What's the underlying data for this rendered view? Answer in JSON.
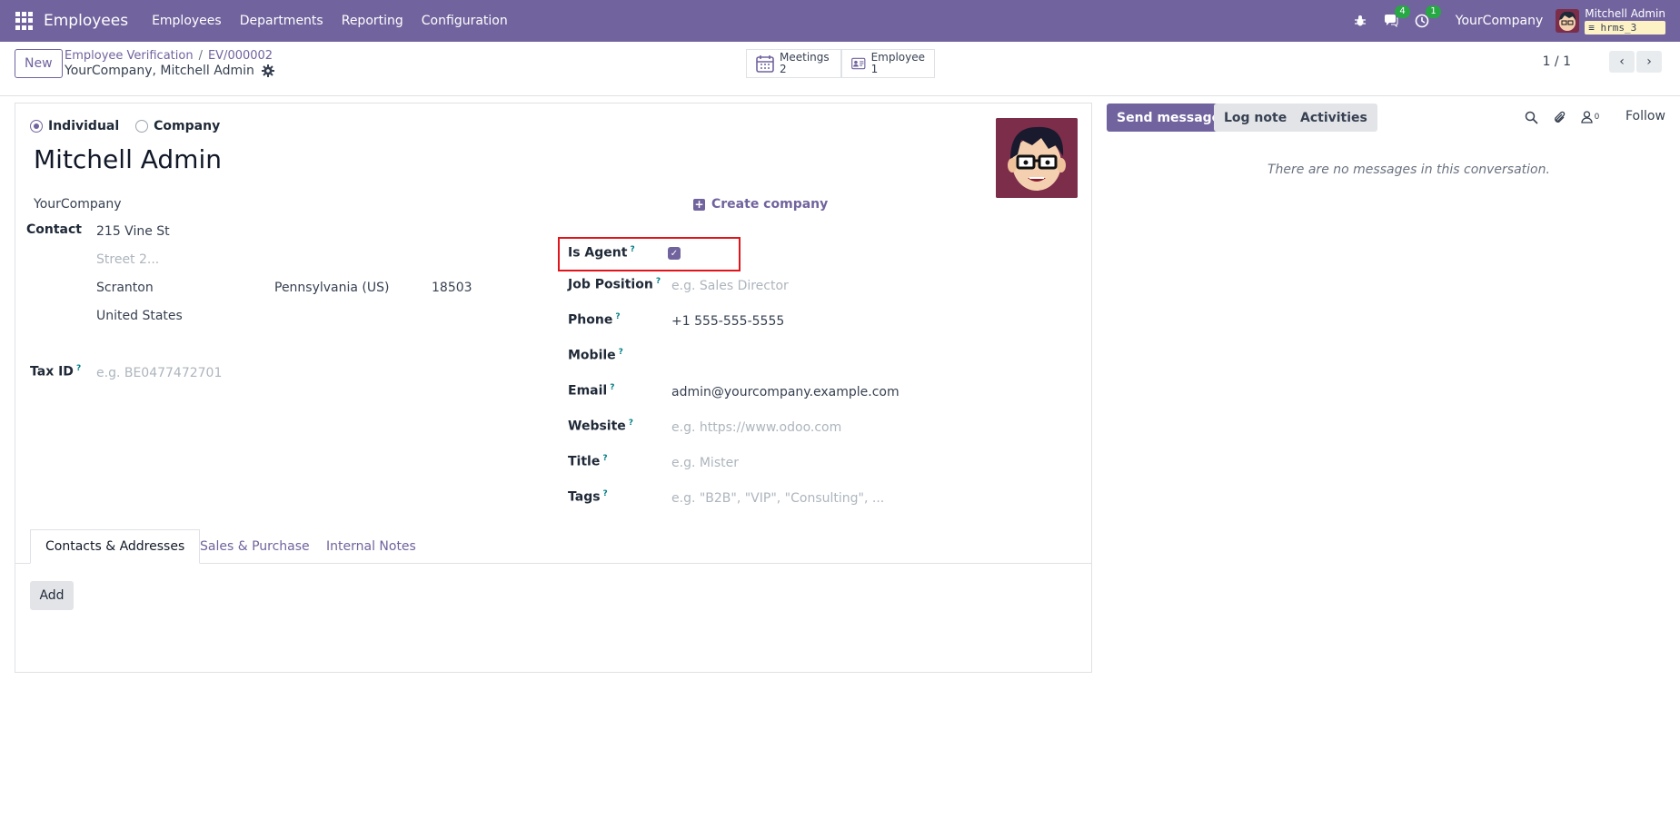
{
  "navbar": {
    "brand": "Employees",
    "menu": [
      "Employees",
      "Departments",
      "Reporting",
      "Configuration"
    ],
    "messages_badge": "4",
    "activities_badge": "1",
    "company": "YourCompany",
    "user_name": "Mitchell Admin",
    "db_name": "hrms_3"
  },
  "control": {
    "new_label": "New",
    "breadcrumb_parent": "Employee Verification",
    "breadcrumb_current": "EV/000002",
    "record_subtitle": "YourCompany, Mitchell Admin",
    "smart_buttons": [
      {
        "label": "Meetings",
        "count": "2"
      },
      {
        "label": "Employee",
        "count": "1"
      }
    ],
    "pager": "1 / 1"
  },
  "form": {
    "type_options": [
      "Individual",
      "Company"
    ],
    "selected_type": "Individual",
    "name": "Mitchell Admin",
    "company": "YourCompany",
    "create_company": "Create company",
    "contact_label": "Contact",
    "street": "215 Vine St",
    "street2_placeholder": "Street 2...",
    "city": "Scranton",
    "state": "Pennsylvania (US)",
    "zip": "18503",
    "country": "United States",
    "tax_id_label": "Tax ID",
    "tax_id_placeholder": "e.g. BE0477472701",
    "is_agent_label": "Is Agent",
    "is_agent": true,
    "job_position_label": "Job Position",
    "job_position_placeholder": "e.g. Sales Director",
    "phone_label": "Phone",
    "phone": "+1 555-555-5555",
    "mobile_label": "Mobile",
    "email_label": "Email",
    "email": "admin@yourcompany.example.com",
    "website_label": "Website",
    "website_placeholder": "e.g. https://www.odoo.com",
    "title_label": "Title",
    "title_placeholder": "e.g. Mister",
    "tags_label": "Tags",
    "tags_placeholder": "e.g. \"B2B\", \"VIP\", \"Consulting\", ...",
    "help_mark": "?"
  },
  "notebook": {
    "tabs": [
      "Contacts & Addresses",
      "Sales & Purchase",
      "Internal Notes"
    ],
    "active_tab": "Contacts & Addresses",
    "add_label": "Add"
  },
  "chatter": {
    "send_message": "Send message",
    "log_note": "Log note",
    "activities": "Activities",
    "followers_count": "0",
    "follow": "Follow",
    "empty_text": "There are no messages in this conversation."
  },
  "colors": {
    "brand": "#71639e",
    "highlight": "#e0151b",
    "badge": "#28a745"
  }
}
